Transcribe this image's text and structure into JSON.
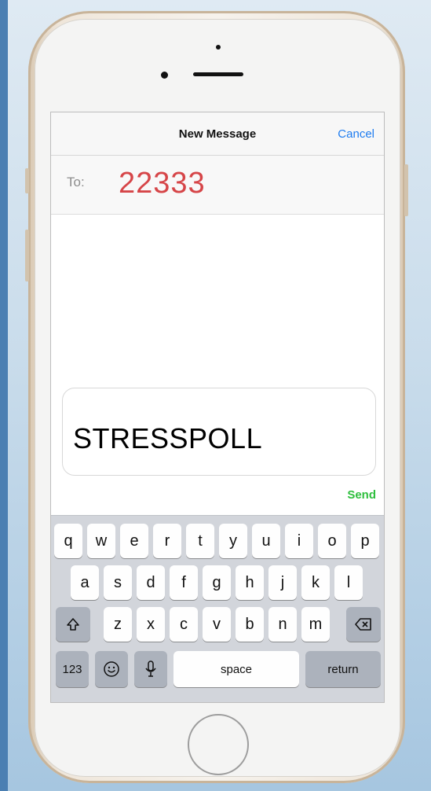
{
  "navbar": {
    "title": "New Message",
    "cancel_label": "Cancel"
  },
  "recipient": {
    "label": "To:",
    "value": "22333"
  },
  "message": {
    "text": "STRESSPOLL"
  },
  "send_label": "Send",
  "keyboard": {
    "row1": [
      "q",
      "w",
      "e",
      "r",
      "t",
      "y",
      "u",
      "i",
      "o",
      "p"
    ],
    "row2": [
      "a",
      "s",
      "d",
      "f",
      "g",
      "h",
      "j",
      "k",
      "l"
    ],
    "row3": [
      "z",
      "x",
      "c",
      "v",
      "b",
      "n",
      "m"
    ],
    "numbers_label": "123",
    "space_label": "space",
    "return_label": "return"
  },
  "colors": {
    "cancel": "#1e7cf0",
    "recipient": "#d64548",
    "send": "#2fbf3e"
  }
}
